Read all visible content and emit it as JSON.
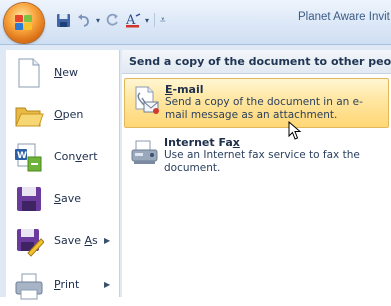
{
  "window": {
    "title": "Planet Aware Invit"
  },
  "quick_access": [
    "save-icon",
    "undo-icon",
    "redo-icon",
    "format-icon",
    "customize-icon"
  ],
  "menu": {
    "items": [
      {
        "label": "New",
        "mnemonic": "N",
        "rest": "ew",
        "icon": "new-document-icon",
        "has_submenu": false
      },
      {
        "label": "Open",
        "mnemonic": "O",
        "rest": "pen",
        "icon": "open-folder-icon",
        "has_submenu": false
      },
      {
        "label": "Convert",
        "pre": "Con",
        "mnemonic": "v",
        "rest": "ert",
        "icon": "convert-icon",
        "has_submenu": false
      },
      {
        "label": "Save",
        "mnemonic": "S",
        "rest": "ave",
        "icon": "save-disk-icon",
        "has_submenu": false
      },
      {
        "label": "Save As",
        "pre": "Save ",
        "mnemonic": "A",
        "rest": "s",
        "icon": "save-as-icon",
        "has_submenu": true
      },
      {
        "label": "Print",
        "mnemonic": "P",
        "rest": "rint",
        "icon": "printer-icon",
        "has_submenu": true
      }
    ]
  },
  "panel": {
    "heading": "Send a copy of the document to other people",
    "options": [
      {
        "title": "E-mail",
        "title_mnemonic": "E",
        "title_rest": "-mail",
        "description": "Send a copy of the document in an e-mail message as an attachment.",
        "icon": "email-icon",
        "highlighted": true
      },
      {
        "title": "Internet Fax",
        "title_pre": "Internet Fa",
        "title_mnemonic": "x",
        "title_rest": "",
        "description": "Use an Internet fax service to fax the document.",
        "icon": "fax-icon",
        "highlighted": false
      }
    ]
  },
  "colors": {
    "highlight": "#ffe6a0",
    "menu_bg": "#dfe9f5",
    "accent": "#f8a43c"
  }
}
